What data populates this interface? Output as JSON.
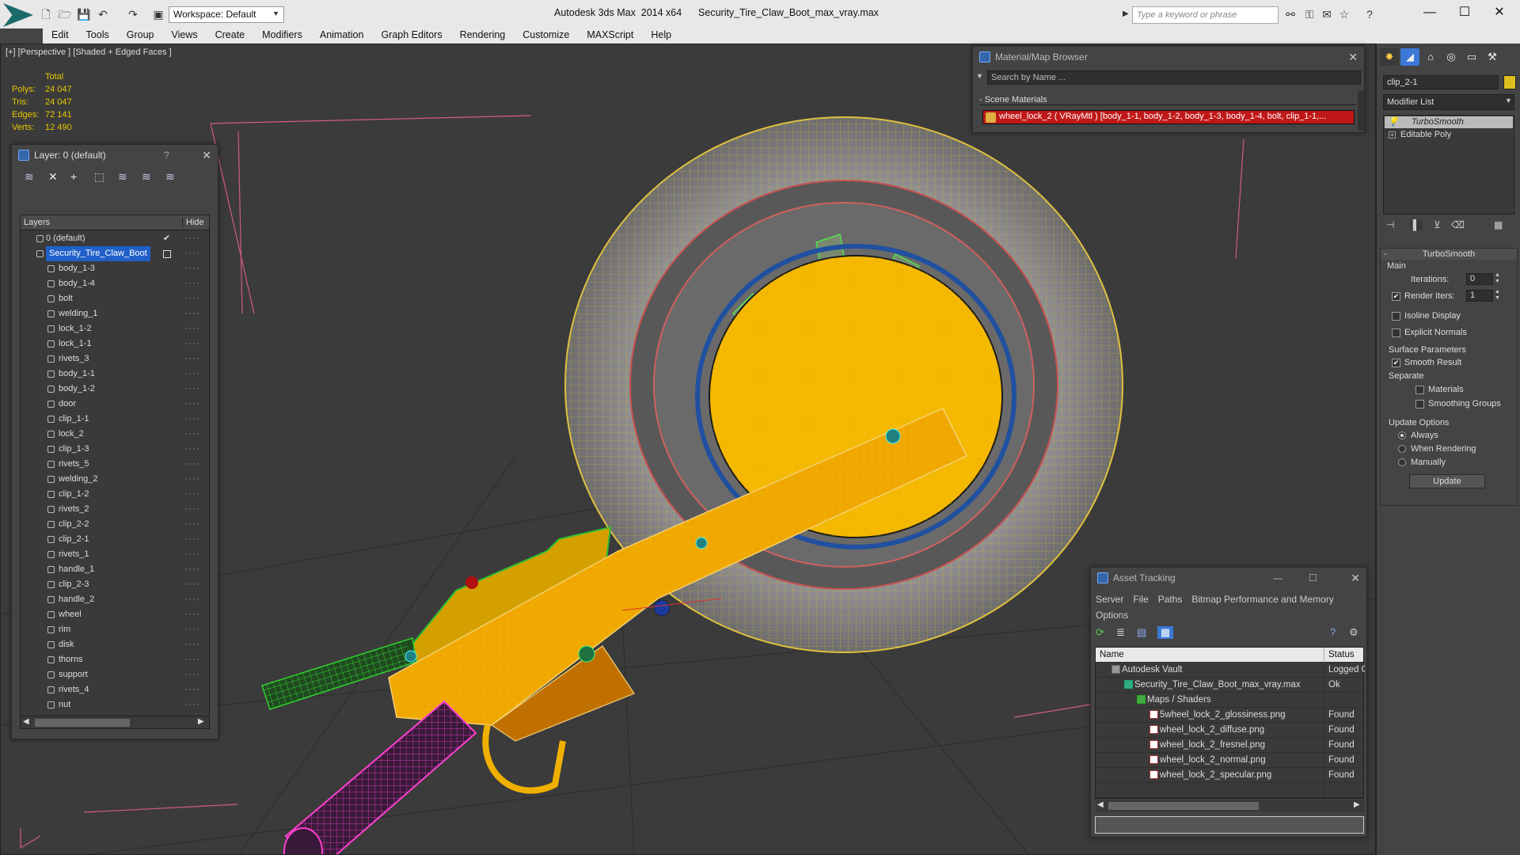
{
  "app": {
    "title": "Autodesk 3ds Max  2014 x64      Security_Tire_Claw_Boot_max_vray.max",
    "workspace": "Workspace: Default",
    "search_placeholder": "Type a keyword or phrase"
  },
  "menu": [
    "Edit",
    "Tools",
    "Group",
    "Views",
    "Create",
    "Modifiers",
    "Animation",
    "Graph Editors",
    "Rendering",
    "Customize",
    "MAXScript",
    "Help"
  ],
  "viewport": {
    "label": "[+] [Perspective ] [Shaded + Edged Faces ]",
    "stats": {
      "header": "Total",
      "rows": [
        {
          "label": "Polys:",
          "value": "24 047"
        },
        {
          "label": "Tris:",
          "value": "24 047"
        },
        {
          "label": "Edges:",
          "value": "72 141"
        },
        {
          "label": "Verts:",
          "value": "12 490"
        }
      ]
    }
  },
  "layer_panel": {
    "title": "Layer: 0 (default)",
    "help": "?",
    "col_layers": "Layers",
    "col_hide": "Hide",
    "layers": [
      {
        "name": "0 (default)",
        "level": 0
      },
      {
        "name": "Security_Tire_Claw_Boot",
        "level": 0,
        "selected": true
      },
      {
        "name": "body_1-3",
        "level": 1
      },
      {
        "name": "body_1-4",
        "level": 1
      },
      {
        "name": "bolt",
        "level": 1
      },
      {
        "name": "welding_1",
        "level": 1
      },
      {
        "name": "lock_1-2",
        "level": 1
      },
      {
        "name": "lock_1-1",
        "level": 1
      },
      {
        "name": "rivets_3",
        "level": 1
      },
      {
        "name": "body_1-1",
        "level": 1
      },
      {
        "name": "body_1-2",
        "level": 1
      },
      {
        "name": "door",
        "level": 1
      },
      {
        "name": "clip_1-1",
        "level": 1
      },
      {
        "name": "lock_2",
        "level": 1
      },
      {
        "name": "clip_1-3",
        "level": 1
      },
      {
        "name": "rivets_5",
        "level": 1
      },
      {
        "name": "welding_2",
        "level": 1
      },
      {
        "name": "clip_1-2",
        "level": 1
      },
      {
        "name": "rivets_2",
        "level": 1
      },
      {
        "name": "clip_2-2",
        "level": 1
      },
      {
        "name": "clip_2-1",
        "level": 1
      },
      {
        "name": "rivets_1",
        "level": 1
      },
      {
        "name": "handle_1",
        "level": 1
      },
      {
        "name": "clip_2-3",
        "level": 1
      },
      {
        "name": "handle_2",
        "level": 1
      },
      {
        "name": "wheel",
        "level": 1
      },
      {
        "name": "rim",
        "level": 1
      },
      {
        "name": "disk",
        "level": 1
      },
      {
        "name": "thorns",
        "level": 1
      },
      {
        "name": "support",
        "level": 1
      },
      {
        "name": "rivets_4",
        "level": 1
      },
      {
        "name": "nut",
        "level": 1
      },
      {
        "name": "Security_Tire_Claw_Boot",
        "level": 1
      }
    ]
  },
  "material_browser": {
    "title": "Material/Map Browser",
    "search_placeholder": "Search by Name ...",
    "section": "- Scene Materials",
    "material": "wheel_lock_2  ( VRayMtl )  [body_1-1, body_1-2, body_1-3, body_1-4, bolt, clip_1-1,..."
  },
  "asset_tracking": {
    "title": "Asset Tracking",
    "menu": [
      "Server",
      "File",
      "Paths",
      "Bitmap Performance and Memory",
      "Options"
    ],
    "col_name": "Name",
    "col_status": "Status",
    "rows": [
      {
        "name": "Autodesk Vault",
        "status": "Logged O",
        "indent": 0,
        "icon": "vault"
      },
      {
        "name": "Security_Tire_Claw_Boot_max_vray.max",
        "status": "Ok",
        "indent": 1,
        "icon": "max"
      },
      {
        "name": "Maps / Shaders",
        "status": "",
        "indent": 2,
        "icon": "folder"
      },
      {
        "name": "5wheel_lock_2_glossiness.png",
        "status": "Found",
        "indent": 3,
        "icon": "png"
      },
      {
        "name": "wheel_lock_2_diffuse.png",
        "status": "Found",
        "indent": 3,
        "icon": "png"
      },
      {
        "name": "wheel_lock_2_fresnel.png",
        "status": "Found",
        "indent": 3,
        "icon": "png"
      },
      {
        "name": "wheel_lock_2_normal.png",
        "status": "Found",
        "indent": 3,
        "icon": "png"
      },
      {
        "name": "wheel_lock_2_specular.png",
        "status": "Found",
        "indent": 3,
        "icon": "png"
      }
    ]
  },
  "command_panel": {
    "object_name": "clip_2-1",
    "modifier_list": "Modifier List",
    "stack": [
      "TurboSmooth",
      "Editable Poly"
    ],
    "rollout_title": "TurboSmooth",
    "main_label": "Main",
    "iterations_label": "Iterations:",
    "iterations_value": "0",
    "render_iters_label": "Render Iters:",
    "render_iters_value": "1",
    "isoline": "Isoline Display",
    "explicit_normals": "Explicit Normals",
    "surface_params": "Surface Parameters",
    "smooth_result": "Smooth Result",
    "separate": "Separate",
    "materials": "Materials",
    "smoothing_groups": "Smoothing Groups",
    "update_options": "Update Options",
    "always": "Always",
    "when_rendering": "When Rendering",
    "manually": "Manually",
    "update_btn": "Update"
  },
  "colors": {
    "accent": "#3b78d8",
    "wire_yellow": "#f5b800",
    "wire_pink": "#e040c0",
    "wire_green": "#2f9a2f",
    "selection_blue": "#2060c8"
  }
}
